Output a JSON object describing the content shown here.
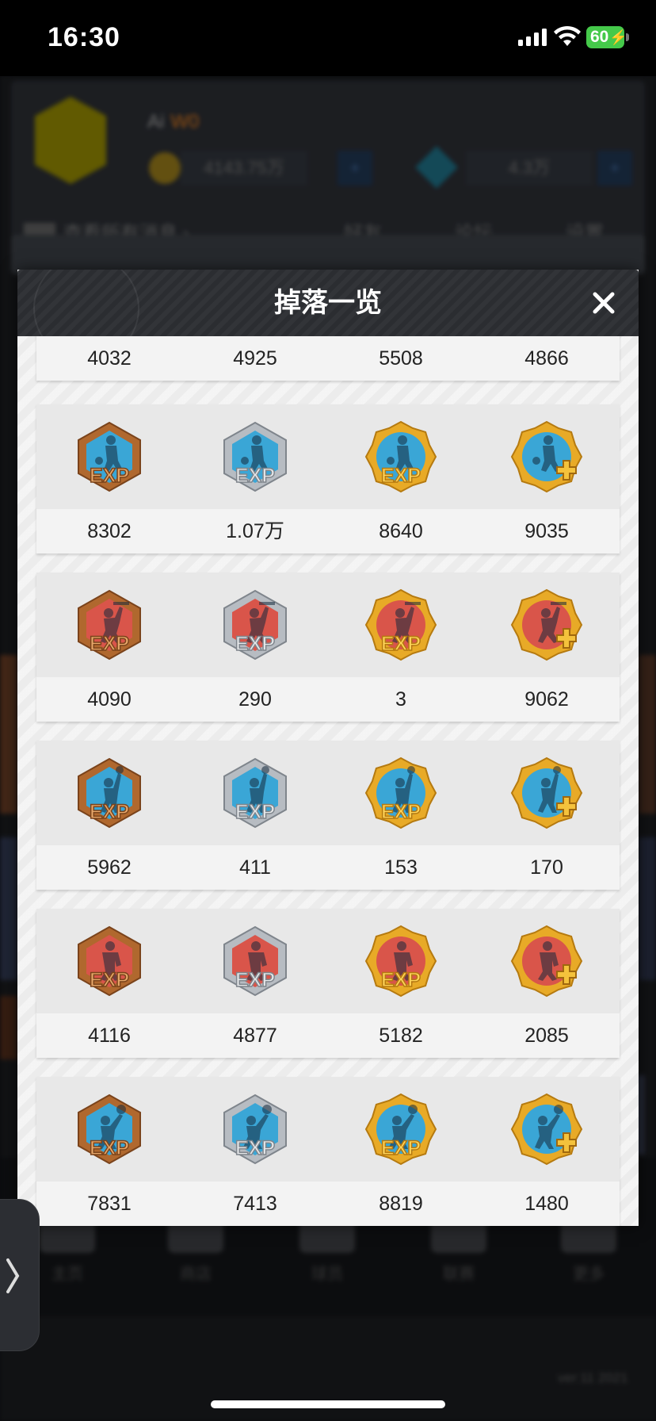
{
  "status_bar": {
    "time": "16:30",
    "battery": "60"
  },
  "background": {
    "username": "Ai",
    "vip": "W0",
    "gold": "4143.75万",
    "gems": "4.3万",
    "news": "查看所有消息",
    "menu": [
      "好友",
      "论坛",
      "设置"
    ],
    "nav": [
      "主页",
      "商店",
      "球员",
      "联赛",
      "更多"
    ],
    "version": "ver:11 2021"
  },
  "modal": {
    "title": "掉落一览",
    "top_row": [
      "4032",
      "4925",
      "5508",
      "4866"
    ],
    "rows": [
      {
        "theme": "blue",
        "pose": "dribble",
        "values": [
          "8302",
          "1.07万",
          "8640",
          "9035"
        ]
      },
      {
        "theme": "red",
        "pose": "dunk",
        "values": [
          "4090",
          "290",
          "3",
          "9062"
        ]
      },
      {
        "theme": "blue",
        "pose": "shoot",
        "values": [
          "5962",
          "411",
          "153",
          "170"
        ]
      },
      {
        "theme": "red",
        "pose": "post",
        "values": [
          "4116",
          "4877",
          "5182",
          "2085"
        ]
      },
      {
        "theme": "blue",
        "pose": "rebound",
        "values": [
          "7831",
          "7413",
          "8819",
          "1480"
        ]
      }
    ],
    "item_variants": [
      "bronze-exp",
      "silver-exp",
      "gold-exp",
      "gold-plus"
    ],
    "item_icon_names": [
      "exp-medal-bronze-icon",
      "exp-medal-silver-icon",
      "exp-medal-gold-icon",
      "attribute-plus-medal-icon"
    ],
    "colors": {
      "blue_fill": "#3aa6d6",
      "red_fill": "#d9554a",
      "bronze": "#b0682e",
      "silver": "#b7bcc2",
      "gold": "#e8aa27"
    }
  }
}
